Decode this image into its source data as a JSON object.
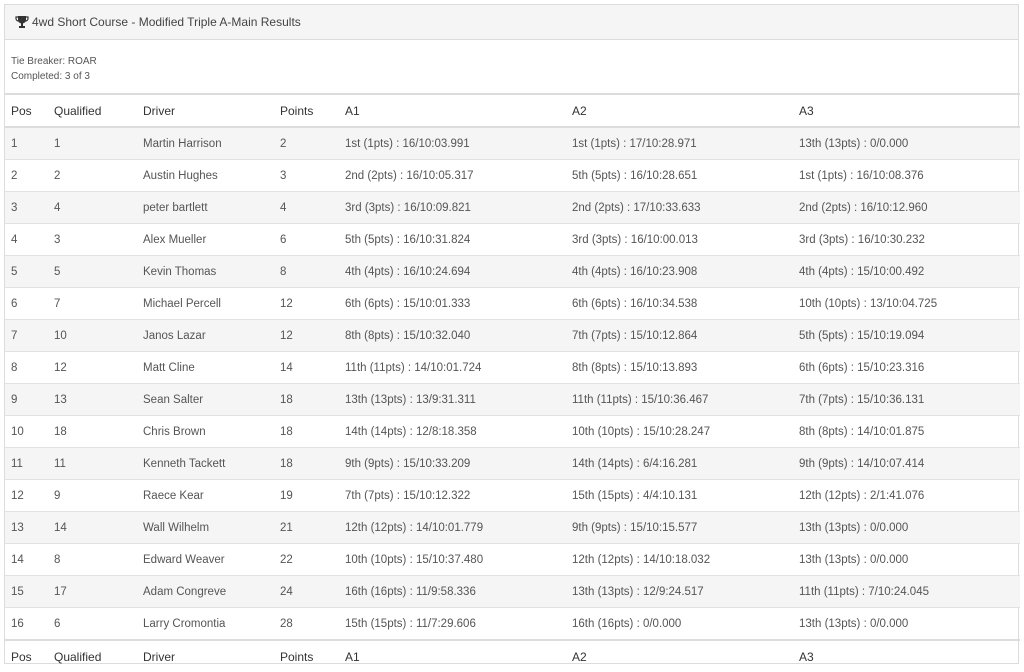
{
  "panel": {
    "title": "4wd Short Course - Modified Triple A-Main Results",
    "trophy_icon": "trophy-icon",
    "tie_breaker": "Tie Breaker: ROAR",
    "completed": "Completed: 3 of 3"
  },
  "columns": [
    "Pos",
    "Qualified",
    "Driver",
    "Points",
    "A1",
    "A2",
    "A3"
  ],
  "rows": [
    [
      "1",
      "1",
      "Martin Harrison",
      "2",
      "1st (1pts) : 16/10:03.991",
      "1st (1pts) : 17/10:28.971",
      "13th (13pts) : 0/0.000"
    ],
    [
      "2",
      "2",
      "Austin Hughes",
      "3",
      "2nd (2pts) : 16/10:05.317",
      "5th (5pts) : 16/10:28.651",
      "1st (1pts) : 16/10:08.376"
    ],
    [
      "3",
      "4",
      "peter bartlett",
      "4",
      "3rd (3pts) : 16/10:09.821",
      "2nd (2pts) : 17/10:33.633",
      "2nd (2pts) : 16/10:12.960"
    ],
    [
      "4",
      "3",
      "Alex Mueller",
      "6",
      "5th (5pts) : 16/10:31.824",
      "3rd (3pts) : 16/10:00.013",
      "3rd (3pts) : 16/10:30.232"
    ],
    [
      "5",
      "5",
      "Kevin Thomas",
      "8",
      "4th (4pts) : 16/10:24.694",
      "4th (4pts) : 16/10:23.908",
      "4th (4pts) : 15/10:00.492"
    ],
    [
      "6",
      "7",
      "Michael Percell",
      "12",
      "6th (6pts) : 15/10:01.333",
      "6th (6pts) : 16/10:34.538",
      "10th (10pts) : 13/10:04.725"
    ],
    [
      "7",
      "10",
      "Janos Lazar",
      "12",
      "8th (8pts) : 15/10:32.040",
      "7th (7pts) : 15/10:12.864",
      "5th (5pts) : 15/10:19.094"
    ],
    [
      "8",
      "12",
      "Matt Cline",
      "14",
      "11th (11pts) : 14/10:01.724",
      "8th (8pts) : 15/10:13.893",
      "6th (6pts) : 15/10:23.316"
    ],
    [
      "9",
      "13",
      "Sean Salter",
      "18",
      "13th (13pts) : 13/9:31.311",
      "11th (11pts) : 15/10:36.467",
      "7th (7pts) : 15/10:36.131"
    ],
    [
      "10",
      "18",
      "Chris Brown",
      "18",
      "14th (14pts) : 12/8:18.358",
      "10th (10pts) : 15/10:28.247",
      "8th (8pts) : 14/10:01.875"
    ],
    [
      "11",
      "11",
      "Kenneth Tackett",
      "18",
      "9th (9pts) : 15/10:33.209",
      "14th (14pts) : 6/4:16.281",
      "9th (9pts) : 14/10:07.414"
    ],
    [
      "12",
      "9",
      "Raece Kear",
      "19",
      "7th (7pts) : 15/10:12.322",
      "15th (15pts) : 4/4:10.131",
      "12th (12pts) : 2/1:41.076"
    ],
    [
      "13",
      "14",
      "Wall Wilhelm",
      "21",
      "12th (12pts) : 14/10:01.779",
      "9th (9pts) : 15/10:15.577",
      "13th (13pts) : 0/0.000"
    ],
    [
      "14",
      "8",
      "Edward Weaver",
      "22",
      "10th (10pts) : 15/10:37.480",
      "12th (12pts) : 14/10:18.032",
      "13th (13pts) : 0/0.000"
    ],
    [
      "15",
      "17",
      "Adam Congreve",
      "24",
      "16th (16pts) : 11/9:58.336",
      "13th (13pts) : 12/9:24.517",
      "11th (11pts) : 7/10:24.045"
    ],
    [
      "16",
      "6",
      "Larry Cromontia",
      "28",
      "15th (15pts) : 11/7:29.606",
      "16th (16pts) : 0/0.000",
      "13th (13pts) : 0/0.000"
    ]
  ]
}
